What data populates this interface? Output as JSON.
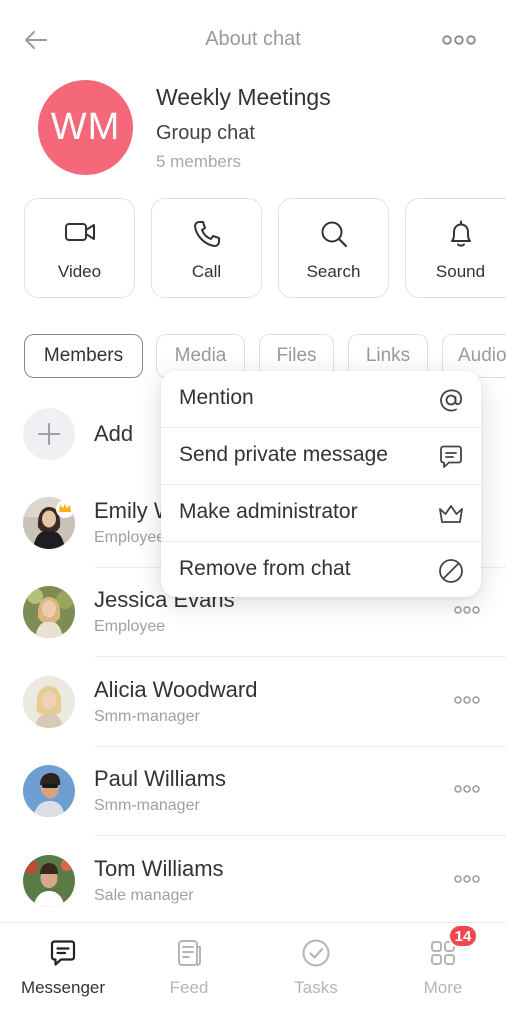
{
  "header": {
    "title": "About chat",
    "back_icon": "arrow-left-icon",
    "more_icon": "more-horizontal-icon"
  },
  "chat": {
    "initials": "WM",
    "name": "Weekly Meetings",
    "type": "Group chat",
    "members_count": "5 members",
    "avatar_color": "#f4687a"
  },
  "actions": [
    {
      "label": "Video",
      "icon": "video-camera-icon"
    },
    {
      "label": "Call",
      "icon": "phone-icon"
    },
    {
      "label": "Search",
      "icon": "search-icon"
    },
    {
      "label": "Sound",
      "icon": "bell-icon"
    }
  ],
  "tabs": [
    "Members",
    "Media",
    "Files",
    "Links",
    "Audio"
  ],
  "add": {
    "label": "Add",
    "icon": "plus-icon"
  },
  "members": [
    {
      "name": "Emily W",
      "role": "Employee"
    },
    {
      "name": "Jessica Evans",
      "role": "Employee"
    },
    {
      "name": "Alicia Woodward",
      "role": "Smm-manager"
    },
    {
      "name": "Paul Williams",
      "role": "Smm-manager"
    },
    {
      "name": "Tom Williams",
      "role": "Sale manager"
    }
  ],
  "context_menu": [
    {
      "label": "Mention",
      "icon": "at-sign-icon"
    },
    {
      "label": "Send private message",
      "icon": "chat-bubble-icon"
    },
    {
      "label": "Make administrator",
      "icon": "crown-icon"
    },
    {
      "label": "Remove from chat",
      "icon": "block-icon"
    }
  ],
  "bottom_nav": [
    {
      "label": "Messenger",
      "icon": "messenger-icon",
      "active": true
    },
    {
      "label": "Feed",
      "icon": "feed-icon",
      "active": false
    },
    {
      "label": "Tasks",
      "icon": "tasks-check-icon",
      "active": false
    },
    {
      "label": "More",
      "icon": "grid-icon",
      "active": false
    }
  ],
  "more_badge": "14",
  "colors": {
    "accent_red": "#f0484e",
    "avatar_pink": "#f4687a",
    "text_muted": "#a0a0a0"
  }
}
